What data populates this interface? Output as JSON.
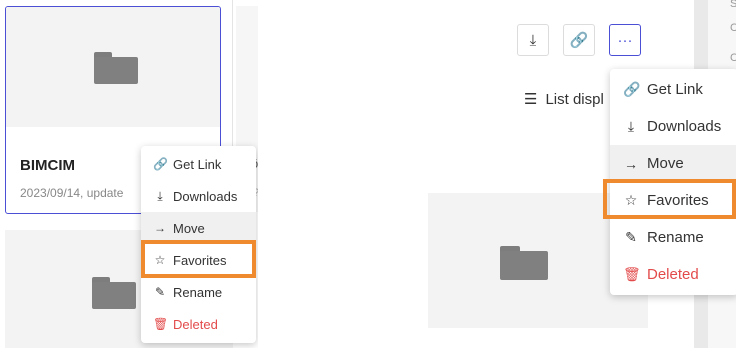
{
  "left_panel": {
    "card": {
      "title": "BIMCIM",
      "date": "2023/09/14, update"
    },
    "menu": [
      {
        "icon": "link-icon",
        "glyph": "🔗",
        "label": "Get Link"
      },
      {
        "icon": "download-icon",
        "glyph": "⤓",
        "label": "Downloads"
      },
      {
        "icon": "arrow-right-icon",
        "glyph": "→",
        "label": "Move"
      },
      {
        "icon": "star-icon",
        "glyph": "☆",
        "label": "Favorites"
      },
      {
        "icon": "pencil-icon",
        "glyph": "✎",
        "label": "Rename"
      },
      {
        "icon": "trash-icon",
        "glyph": "🗑",
        "label": "Deleted"
      }
    ],
    "edge_chars": {
      "card_neighbor": "ö",
      "menu_edge": "?"
    }
  },
  "right_panel": {
    "toolbar": {
      "download_glyph": "⤓",
      "link_glyph": "🔗",
      "more_glyph": "···"
    },
    "list_display": {
      "glyph": "☰",
      "label": "List displ"
    },
    "menu": [
      {
        "icon": "link-icon",
        "glyph": "🔗",
        "label": "Get Link"
      },
      {
        "icon": "download-icon",
        "glyph": "⤓",
        "label": "Downloads"
      },
      {
        "icon": "arrow-right-icon",
        "glyph": "→",
        "label": "Move"
      },
      {
        "icon": "star-icon",
        "glyph": "☆",
        "label": "Favorites"
      },
      {
        "icon": "pencil-icon",
        "glyph": "✎",
        "label": "Rename"
      },
      {
        "icon": "trash-icon",
        "glyph": "🗑",
        "label": "Deleted"
      }
    ],
    "edge_chars": [
      "S",
      "C",
      "C"
    ]
  },
  "colors": {
    "accent": "#4b4fd6",
    "highlight": "#ef8a2f",
    "danger": "#e34b4b",
    "folder": "#808080"
  }
}
